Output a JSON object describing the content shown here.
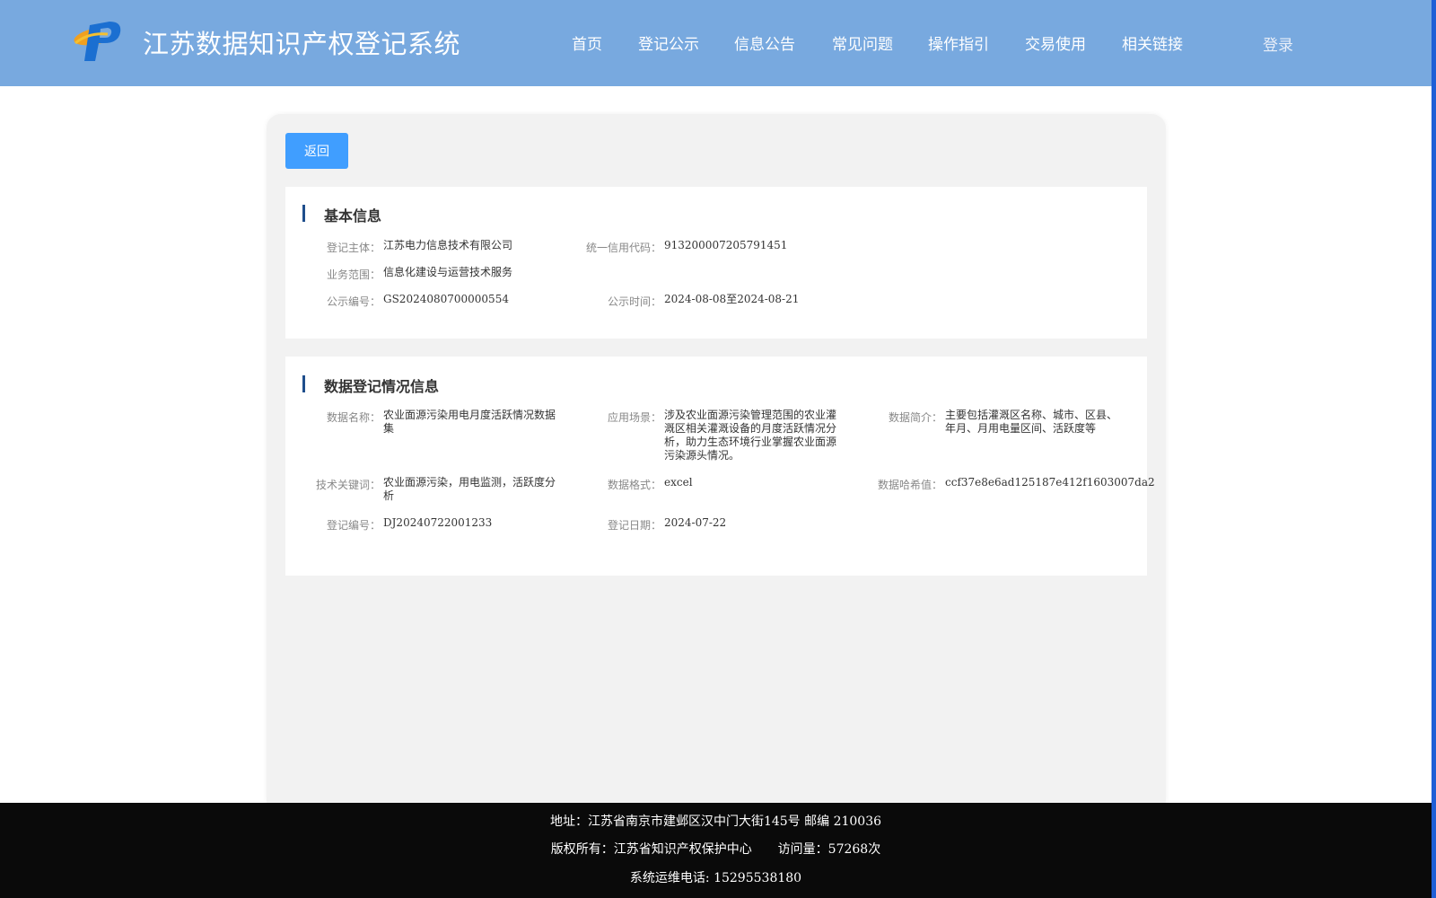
{
  "header": {
    "title": "江苏数据知识产权登记系统",
    "nav": [
      "首页",
      "登记公示",
      "信息公告",
      "常见问题",
      "操作指引",
      "交易使用",
      "相关链接"
    ],
    "login": "登录"
  },
  "back_button": "返回",
  "basic": {
    "title": "基本信息",
    "subject_label": "登记主体：",
    "subject_value": "江苏电力信息技术有限公司",
    "credit_label": "统一信用代码：",
    "credit_value": "913200007205791451",
    "scope_label": "业务范围：",
    "scope_value": "信息化建设与运营技术服务",
    "notice_no_label": "公示编号：",
    "notice_no_value": "GS2024080700000554",
    "notice_time_label": "公示时间：",
    "notice_time_value": "2024-08-08至2024-08-21"
  },
  "data_info": {
    "title": "数据登记情况信息",
    "name_label": "数据名称：",
    "name_value": "农业面源污染用电月度活跃情况数据集",
    "scene_label": "应用场景：",
    "scene_value": "涉及农业面源污染管理范围的农业灌溉区相关灌溉设备的月度活跃情况分析，助力生态环境行业掌握农业面源污染源头情况。",
    "intro_label": "数据简介：",
    "intro_value": "主要包括灌溉区名称、城市、区县、年月、月用电量区间、活跃度等",
    "keywords_label": "技术关键词：",
    "keywords_value": "农业面源污染，用电监测，活跃度分析",
    "format_label": "数据格式：",
    "format_value": "excel",
    "hash_label": "数据哈希值：",
    "hash_value": "ccf37e8e6ad125187e412f1603007da2",
    "reg_no_label": "登记编号：",
    "reg_no_value": "DJ20240722001233",
    "reg_date_label": "登记日期：",
    "reg_date_value": "2024-07-22"
  },
  "footer": {
    "address": "地址：江苏省南京市建邺区汉中门大街145号 邮编 210036",
    "copyright": "版权所有：江苏省知识产权保护中心",
    "visits": "访问量：57268次",
    "phone": "系统运维电话: 15295538180"
  },
  "colors": {
    "header_bg": "#78a9df",
    "button_bg": "#409eff",
    "section_bar": "#1f4e8c",
    "footer_bg": "#0a0a0a"
  },
  "icons": {
    "logo": "ip-logo"
  }
}
